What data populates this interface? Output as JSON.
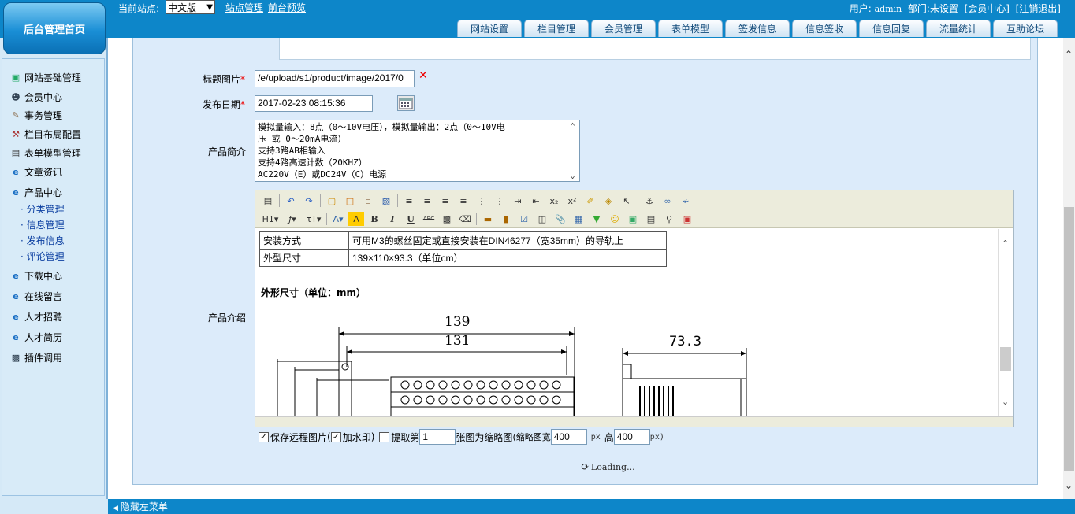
{
  "header": {
    "home_label": "后台管理首页",
    "site_label": "当前站点:",
    "site_selected": "中文版",
    "site_manage": "站点管理",
    "preview": "前台预览",
    "user_label": "用户:",
    "user_name": "admin",
    "dept_label": "部门:",
    "dept_value": "未设置",
    "member_center": "[会员中心]",
    "logout": "[注销退出]",
    "tabs": [
      "网站设置",
      "栏目管理",
      "会员管理",
      "表单模型",
      "签发信息",
      "信息签收",
      "信息回复",
      "流量统计",
      "互助论坛"
    ]
  },
  "sidebar": {
    "items": [
      {
        "label": "网站基础管理",
        "icon": "site-config-icon"
      },
      {
        "label": "会员中心",
        "icon": "members-icon"
      },
      {
        "label": "事务管理",
        "icon": "affairs-icon"
      },
      {
        "label": "栏目布局配置",
        "icon": "tools-icon"
      },
      {
        "label": "表单模型管理",
        "icon": "form-model-icon"
      },
      {
        "label": "文章资讯",
        "icon": "ie-icon"
      },
      {
        "label": "产品中心",
        "icon": "ie-icon"
      },
      {
        "label": "下载中心",
        "icon": "ie-icon"
      },
      {
        "label": "在线留言",
        "icon": "ie-icon"
      },
      {
        "label": "人才招聘",
        "icon": "ie-icon"
      },
      {
        "label": "人才简历",
        "icon": "ie-icon"
      },
      {
        "label": "插件调用",
        "icon": "plugin-icon"
      }
    ],
    "product_sub": [
      "· 分类管理",
      "· 信息管理",
      "· 发布信息",
      "· 评论管理"
    ]
  },
  "form": {
    "image_label": "标题图片",
    "image_value": "/e/upload/s1/product/image/2017/0",
    "date_label": "发布日期",
    "date_value": "2017-02-23 08:15:36",
    "summary_label": "产品简介",
    "summary_lines": [
      "模拟量输入：8点（0～10V电压），模拟量输出：2点（0～10V电",
      "压 或 0～20mA电流）",
      "支持3路AB相输入",
      "支持4路高速计数（20KHZ）",
      "AC220V（E）或DC24V（C）电源"
    ],
    "intro_label": "产品介绍",
    "required_mark": "*"
  },
  "editor": {
    "spec_rows": [
      {
        "key": "安装方式",
        "value": "可用M3的螺丝固定或直接安装在DIN46277（宽35mm）的导轨上"
      },
      {
        "key": "外型尺寸",
        "value": "139×110×93.3（单位cm）"
      }
    ],
    "dim_title": "外形尺寸（单位：mm）",
    "drawing_dims": [
      "139",
      "131",
      "73.3"
    ],
    "toolbar_text": {
      "h1": "H1",
      "bold": "B",
      "italic": "I",
      "underline": "U",
      "strike": "ABC"
    }
  },
  "options": {
    "save_remote": "保存远程图片",
    "paren_open": "(",
    "watermark": "加水印",
    "paren_close": ")",
    "extract_prefix": "提取第",
    "extract_value": "1",
    "extract_suffix": "张图为缩略图",
    "thumb_width_label": "(缩略图宽",
    "thumb_width": "400",
    "px": "px",
    "thumb_height_label": "高",
    "thumb_height": "400",
    "px_close": "px)"
  },
  "loading": "Loading...",
  "footer": {
    "hide_menu": "隐藏左菜单"
  },
  "colors": {
    "header_blue": "#0d86c9",
    "panel_bg": "#dcebfa",
    "sidebar_bg": "#d5e9f7"
  }
}
